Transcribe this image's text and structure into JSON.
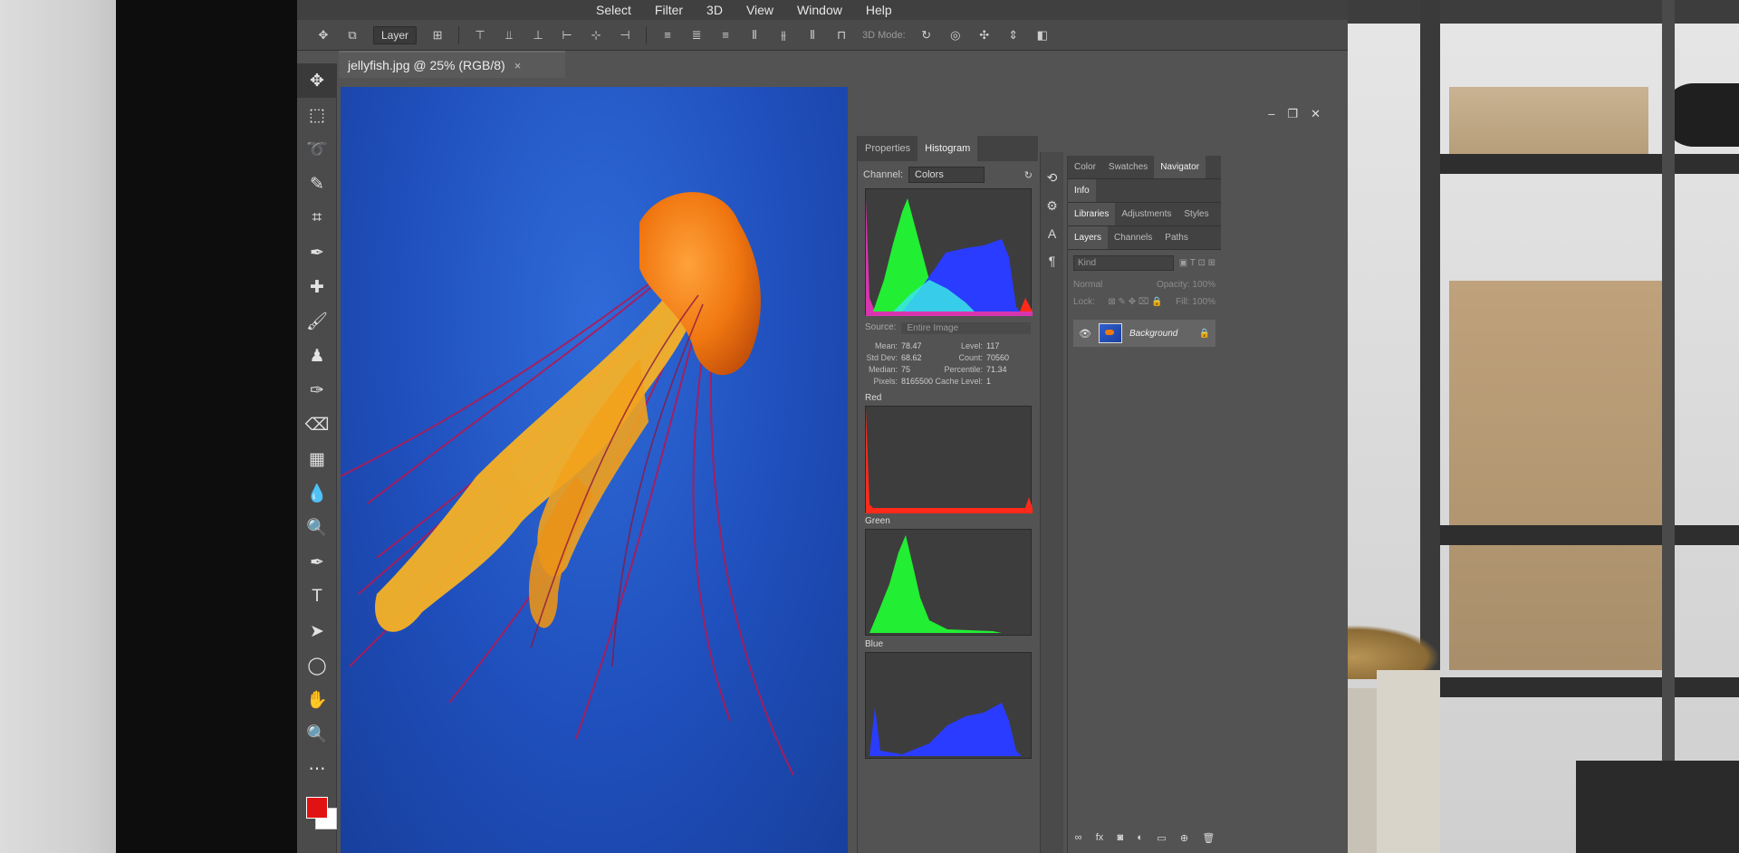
{
  "menu": {
    "items": [
      "Select",
      "Filter",
      "3D",
      "View",
      "Window",
      "Help"
    ]
  },
  "options_bar": {
    "layer_dropdown": "Layer",
    "mode_3d": "3D Mode:"
  },
  "document": {
    "tab_title": "jellyfish.jpg @ 25% (RGB/8)",
    "close_glyph": "×"
  },
  "histogram_panel": {
    "tabs": [
      "Properties",
      "Histogram"
    ],
    "active_tab": "Histogram",
    "channel_label": "Channel:",
    "channel_value": "Colors",
    "source_label": "Source:",
    "source_value": "Entire Image",
    "stats": {
      "mean_label": "Mean:",
      "mean": "78.47",
      "std_dev_label": "Std Dev:",
      "std_dev": "68.62",
      "median_label": "Median:",
      "median": "75",
      "pixels_label": "Pixels:",
      "pixels": "8165500",
      "level_label": "Level:",
      "level": "117",
      "count_label": "Count:",
      "count": "70560",
      "percentile_label": "Percentile:",
      "percentile": "71.34",
      "cache_label": "Cache Level:",
      "cache": "1"
    },
    "channels": [
      "Red",
      "Green",
      "Blue"
    ],
    "colors": {
      "red": "#ff2a1a",
      "green": "#22ee33",
      "blue": "#2a3cff",
      "cyan": "#39e6e6",
      "magenta": "#ff33cc"
    }
  },
  "right_panel": {
    "top_tabs": [
      "Color",
      "Swatches",
      "Navigator"
    ],
    "info_tab": "Info",
    "mid_tabs": [
      "Libraries",
      "Adjustments",
      "Styles"
    ],
    "layer_tabs": [
      "Layers",
      "Channels",
      "Paths"
    ],
    "search_placeholder": "Kind",
    "blend_mode": "Normal",
    "opacity_label": "Opacity:",
    "opacity_value": "100%",
    "lock_label": "Lock:",
    "fill_label": "Fill:",
    "fill_value": "100%",
    "layer_name": "Background"
  },
  "swatch_colors": {
    "foreground": "#e31212",
    "background": "#ffffff"
  }
}
